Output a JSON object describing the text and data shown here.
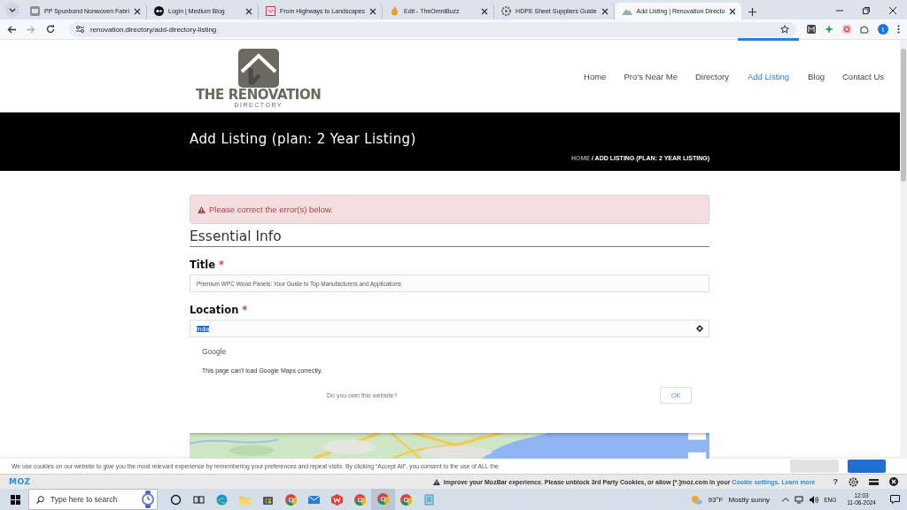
{
  "browser": {
    "tabs": [
      {
        "title": "PP Spunbond Nonwoven Fabri",
        "selected": false
      },
      {
        "title": "Login | Medium Blog",
        "selected": false
      },
      {
        "title": "From Highways to Landscapes",
        "selected": false
      },
      {
        "title": "Edit - TheOmniBuzz",
        "selected": false
      },
      {
        "title": "HDPE Sheet Suppliers Guide",
        "selected": false
      },
      {
        "title": "Add Listing | Renovation Directo",
        "selected": true
      }
    ],
    "url": "renovation.directory/add-directory-listing",
    "profile_initial": "t"
  },
  "site": {
    "logo": {
      "name": "THE RENOVATION",
      "tagline": "DIRECTORY"
    },
    "nav": [
      {
        "label": "Home",
        "selected": false
      },
      {
        "label": "Pro’s Near Me",
        "selected": false
      },
      {
        "label": "Directory",
        "selected": false
      },
      {
        "label": "Add Listing",
        "selected": true
      },
      {
        "label": "Blog",
        "selected": false
      },
      {
        "label": "Contact Us",
        "selected": false
      }
    ],
    "page_title": "Add Listing (plan: 2 Year Listing)",
    "breadcrumb": {
      "home": "HOME",
      "current": "/ ADD LISTING (PLAN: 2 YEAR LISTING)"
    }
  },
  "form": {
    "alert": "Please correct the error(s) below.",
    "section": "Essential Info",
    "fields": [
      {
        "label": "Title",
        "required_mark": "*",
        "value": "Premium WPC Wood Panels: Your Guide to Top Manufacturers and Applications",
        "text_selected": false
      },
      {
        "label": "Location",
        "required_mark": "*",
        "value": "India",
        "text_selected": true
      }
    ]
  },
  "map_dialog": {
    "brand": "Google",
    "message": "This page can't load Google Maps correctly.",
    "link": "Do you own this website?",
    "button": "OK"
  },
  "cookie_notice": "We use cookies on our website to give you the most relevant experience by remembering your preferences and repeat visits. By clicking “Accept All”, you consent to the use of ALL the",
  "mozbar": {
    "logo": "MOZ",
    "message": "Improve your MozBar experience. Please unblock 3rd Party Cookies, or allow [*.]moz.com in your",
    "links": [
      "Cookie settings.",
      "Learn more"
    ],
    "help": "?"
  },
  "taskbar": {
    "search_placeholder": "Type here to search",
    "temperature": "93°F",
    "condition": "Mostly sunny",
    "language": "ENG",
    "time": "12:03",
    "date": "11-06-2024"
  }
}
